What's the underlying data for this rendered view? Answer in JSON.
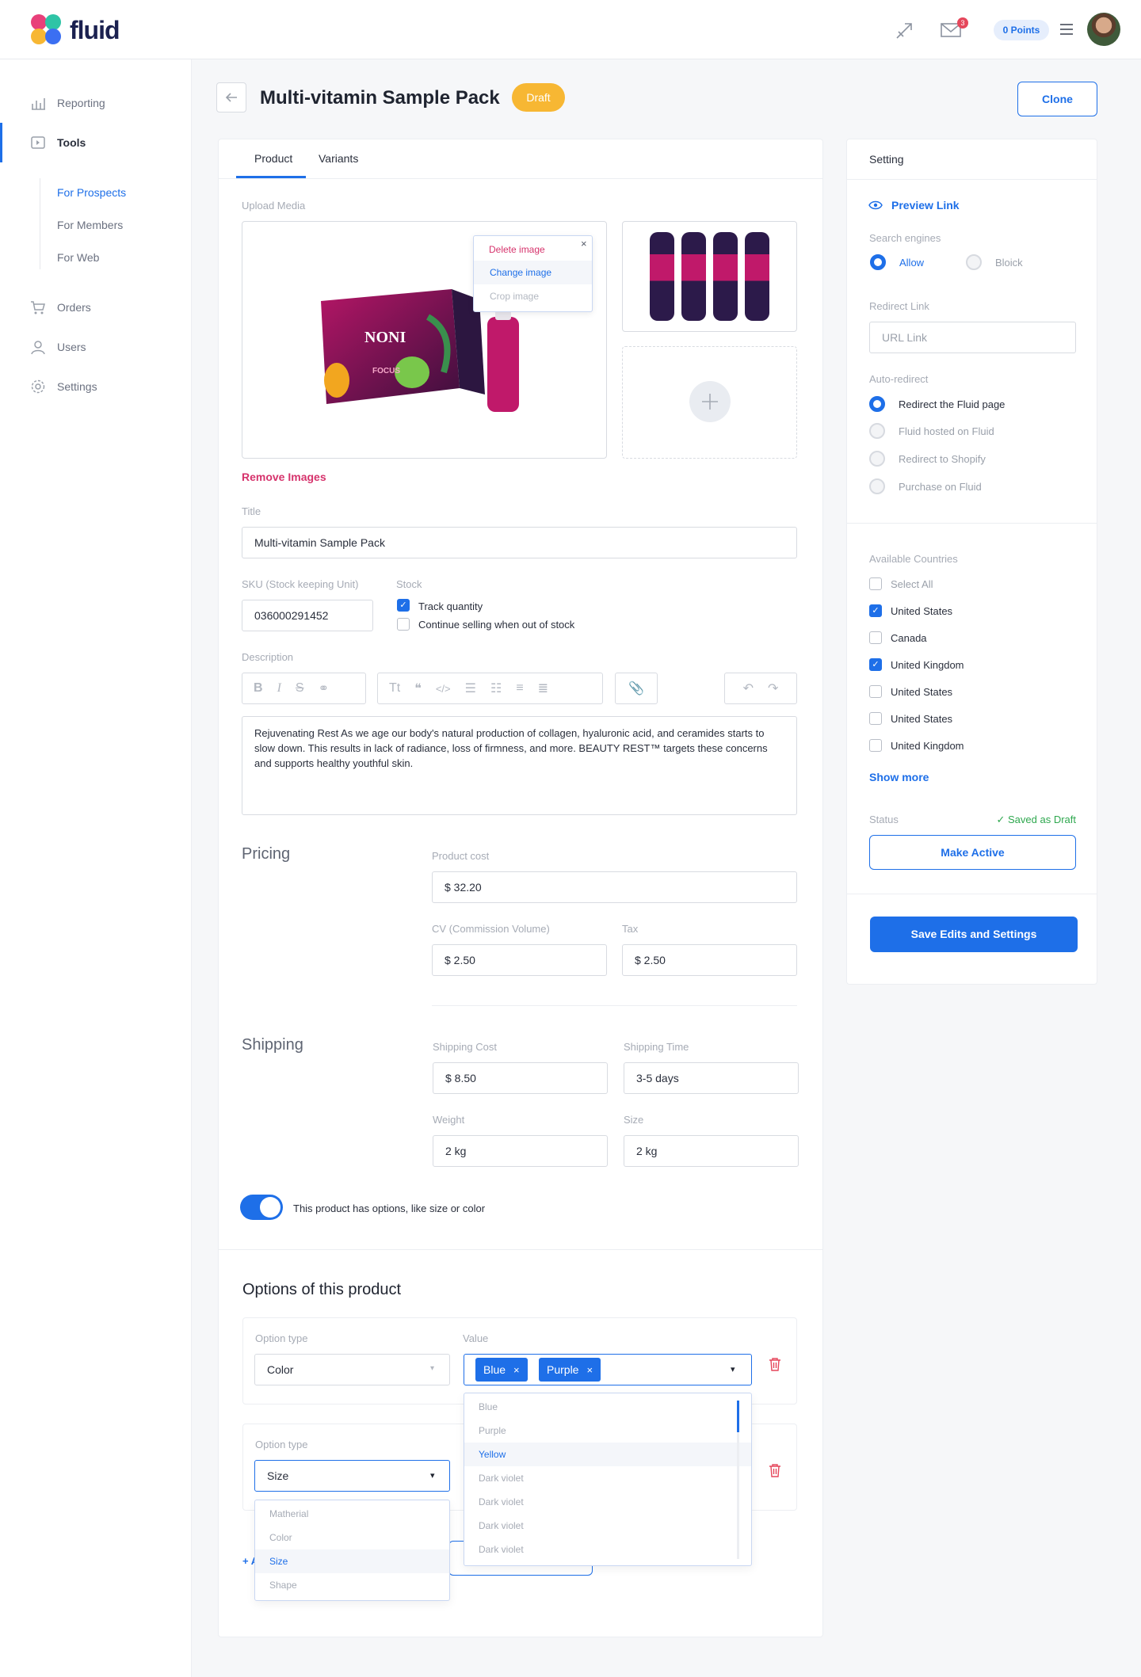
{
  "app": {
    "logo_text": "fluid",
    "points": "0 Points",
    "mail_badge": "3"
  },
  "sidebar": {
    "items": [
      {
        "label": "Reporting"
      },
      {
        "label": "Tools"
      },
      {
        "label": "Orders"
      },
      {
        "label": "Users"
      },
      {
        "label": "Settings"
      }
    ],
    "subitems": [
      {
        "label": "For Prospects"
      },
      {
        "label": "For Members"
      },
      {
        "label": "For Web"
      }
    ]
  },
  "header": {
    "title": "Multi-vitamin Sample Pack",
    "status_badge": "Draft",
    "clone_label": "Clone"
  },
  "tabs": [
    {
      "label": "Product"
    },
    {
      "label": "Variants"
    }
  ],
  "media": {
    "label": "Upload Media",
    "menu": [
      "Delete image",
      "Change image",
      "Crop image"
    ],
    "remove_label": "Remove Images",
    "product_brand": "NONI",
    "product_sub": "FOCUS"
  },
  "form": {
    "title_label": "Title",
    "title_value": "Multi-vitamin Sample Pack",
    "sku_label": "SKU (Stock keeping Unit)",
    "sku_value": "036000291452",
    "stock_label": "Stock",
    "track_qty": "Track quantity",
    "continue_selling": "Continue selling when out of stock",
    "description_label": "Description",
    "description": "Rejuvenating Rest As we age our body's natural production of collagen, hyaluronic acid, and ceramides starts to slow down. This results in lack of radiance, loss of firmness, and more. BEAUTY REST™ targets these concerns and supports healthy youthful skin."
  },
  "pricing": {
    "title": "Pricing",
    "product_cost_label": "Product cost",
    "product_cost": "$ 32.20",
    "cv_label": "CV (Commission Volume)",
    "cv": "$ 2.50",
    "tax_label": "Tax",
    "tax": "$ 2.50"
  },
  "shipping": {
    "title": "Shipping",
    "cost_label": "Shipping Cost",
    "cost": "$ 8.50",
    "time_label": "Shipping Time",
    "time": "3-5 days",
    "weight_label": "Weight",
    "weight": "2 kg",
    "size_label": "Size",
    "size": "2 kg"
  },
  "options_toggle_label": "This product has options, like size or color",
  "options": {
    "title": "Options of this product",
    "option_type_label": "Option type",
    "value_label": "Value",
    "row1_type": "Color",
    "row1_tags": [
      "Blue",
      "Purple"
    ],
    "row2_type": "Size",
    "value_dropdown": [
      "Blue",
      "Purple",
      "Yellow",
      "Dark violet",
      "Dark violet",
      "Dark violet",
      "Dark violet"
    ],
    "type_dropdown": [
      "Matherial",
      "Color",
      "Size",
      "Shape"
    ],
    "add_prefix": "+ A"
  },
  "settings": {
    "title": "Setting",
    "preview_link": "Preview Link",
    "search_engines_label": "Search engines",
    "allow": "Allow",
    "block": "Bloick",
    "redirect_label": "Redirect Link",
    "redirect_placeholder": "URL Link",
    "auto_redirect_label": "Auto-redirect",
    "auto_redirect_options": [
      "Redirect the Fluid page",
      "Fluid hosted on Fluid",
      "Redirect to Shopify",
      "Purchase on Fluid"
    ],
    "countries_label": "Available Countries",
    "countries": [
      {
        "name": "Select All",
        "checked": false
      },
      {
        "name": "United States",
        "checked": true
      },
      {
        "name": "Canada",
        "checked": false
      },
      {
        "name": "United Kingdom",
        "checked": true
      },
      {
        "name": "United States",
        "checked": false
      },
      {
        "name": "United States",
        "checked": false
      },
      {
        "name": "United Kingdom",
        "checked": false
      }
    ],
    "show_more": "Show more",
    "status_label": "Status",
    "status_value": "✓ Saved as Draft",
    "make_active": "Make Active",
    "save_button": "Save Edits and Settings"
  },
  "colors": {
    "accent": "#1e6fe8",
    "draft": "#f7b733",
    "danger": "#e5475b",
    "link_pink": "#d6336c"
  }
}
